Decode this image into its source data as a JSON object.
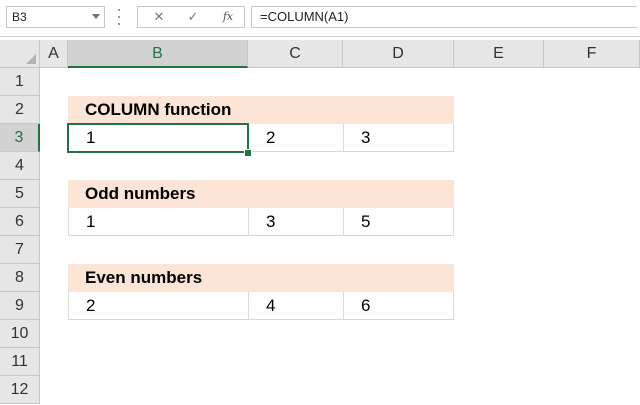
{
  "name_box": {
    "value": "B3"
  },
  "formula_bar": {
    "cancel_icon": "✕",
    "enter_icon": "✓",
    "fx_label": "fx",
    "formula": "=COLUMN(A1)"
  },
  "columns": [
    "A",
    "B",
    "C",
    "D",
    "E",
    "F"
  ],
  "rows": [
    "1",
    "2",
    "3",
    "4",
    "5",
    "6",
    "7",
    "8",
    "9",
    "10",
    "11",
    "12"
  ],
  "selected": {
    "column": "B",
    "row": "3"
  },
  "sections": [
    {
      "title": "COLUMN function",
      "values": [
        "1",
        "2",
        "3"
      ]
    },
    {
      "title": "Odd numbers",
      "values": [
        "1",
        "3",
        "5"
      ]
    },
    {
      "title": "Even numbers",
      "values": [
        "2",
        "4",
        "6"
      ]
    }
  ],
  "colors": {
    "header_fill": "#fce4d6",
    "selection": "#217346"
  }
}
